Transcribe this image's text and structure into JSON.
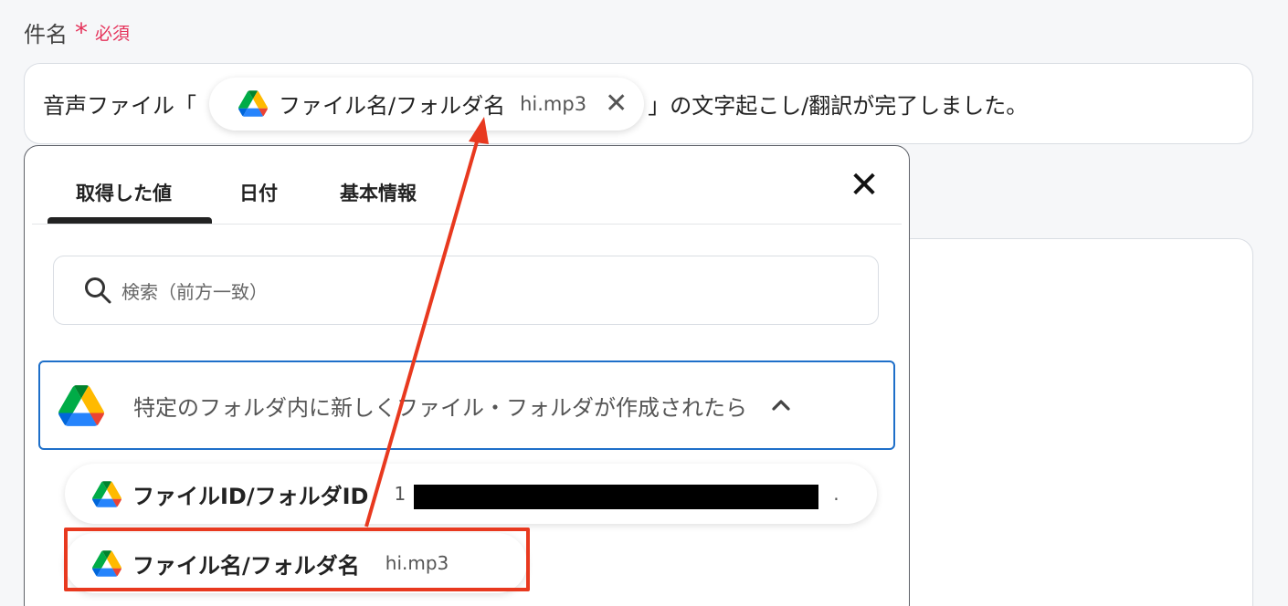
{
  "field": {
    "label": "件名",
    "required_star": "*",
    "required_text": "必須"
  },
  "subject": {
    "prefix": "音声ファイル「",
    "token_label": "ファイル名/フォルダ名",
    "token_sample": "hi.mp3",
    "suffix": "」の文字起こし/翻訳が完了しました。"
  },
  "picker": {
    "tabs": [
      "取得した値",
      "日付",
      "基本情報"
    ],
    "active_tab": "取得した値",
    "search_placeholder": "検索（前方一致）",
    "section_title": "特定のフォルダ内に新しくファイル・フォルダが作成されたら",
    "items": [
      {
        "label": "ファイルID/フォルダID",
        "value": "1",
        "value_tail": "."
      },
      {
        "label": "ファイル名/フォルダ名",
        "value": "hi.mp3"
      }
    ]
  },
  "icons": {
    "drive": "google-drive-icon",
    "close": "close-icon",
    "search": "search-icon",
    "collapse": "chevron-up-icon"
  },
  "colors": {
    "required": "#e5335b",
    "section_border": "#1e6fc9",
    "annotation": "#e8391f"
  }
}
